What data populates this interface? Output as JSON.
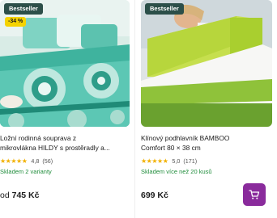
{
  "products": [
    {
      "badge": "Bestseller",
      "discount": "-34 %",
      "title_line1": "Ložní rodinná souprava z",
      "title_line2": "mikrovlákna HILDY s prostěradly a...",
      "stars": "★★★★★",
      "rating": "4,8",
      "reviews": "(56)",
      "stock": "Skladem 2 varianty",
      "price_prefix": "od",
      "price": "745 Kč"
    },
    {
      "badge": "Bestseller",
      "title_line1": "Klínový podhlavník BAMBOO",
      "title_line2": "Comfort 80 × 38 cm",
      "stars": "★★★★★",
      "rating": "5,0",
      "reviews": "(171)",
      "stock": "Skladem více než 20 kusů",
      "price": "699 Kč",
      "cart_icon": "cart-icon",
      "cart_color": "#8a2b9c"
    }
  ],
  "colors": {
    "badge_bg": "#2c4f49",
    "discount_bg": "#f5d300",
    "stock_green": "#1e8c3a",
    "star": "#f2b100"
  }
}
